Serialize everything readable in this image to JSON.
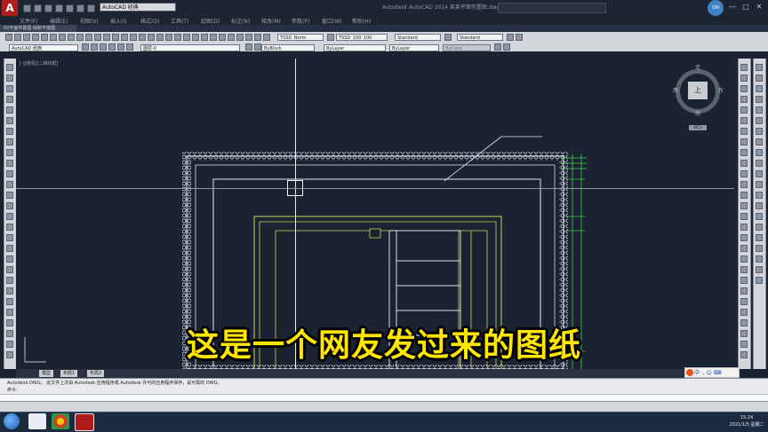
{
  "window": {
    "app_logo": "A",
    "workspace": "AutoCAD 经典",
    "title": "Autodesk AutoCAD 2014   某某平面布置图.dwg",
    "user_badge": "ON",
    "min_glyph": "—",
    "max_glyph": "□",
    "close_glyph": "✕"
  },
  "menu": [
    "文件(F)",
    "编辑(E)",
    "视图(V)",
    "插入(I)",
    "格式(O)",
    "工具(T)",
    "绘图(D)",
    "标注(N)",
    "修改(M)",
    "参数(P)",
    "窗口(W)",
    "帮助(H)"
  ],
  "document_tab": "02平面布置图-绘制平面图",
  "toolbars": {
    "text_style": "TSSD_Norm",
    "dim_style": "TSSD_100_100",
    "table_style": "Standard",
    "multileader_style": "Standard",
    "workspace_combo": "AutoCAD 经典",
    "layer_combo": "图层-0",
    "color_combo": "ByBlock",
    "linetype_combo": "ByLayer",
    "lineweight_combo": "ByLayer",
    "plot_style": "ByColor"
  },
  "viewport": {
    "label": "[-][俯视][二维线框]"
  },
  "viewcube": {
    "north": "北",
    "south": "南",
    "east": "东",
    "west": "西",
    "face": "上",
    "wcs": "WCS"
  },
  "layout_tabs": [
    "模型",
    "布局1",
    "布局2"
  ],
  "command": {
    "line1": "Autodesk DWG。 此文件上次由 Autodesk 应用程序或 Autodesk 许可的应用程序保存，是可靠的 DWG。",
    "line2": "命令:"
  },
  "ime": "中 ·, ☺ ⌨",
  "clock": {
    "time": "15:24",
    "date": "2021/1/5 星期二"
  },
  "subtitle": "这是一个网友发过来的图纸",
  "colors": {
    "viewport_bg": "#1b2231",
    "subtitle": "#ffe600",
    "drawing_line": "#c8d45a",
    "dimension": "#3bd14a",
    "wall": "#d8dcdf"
  }
}
